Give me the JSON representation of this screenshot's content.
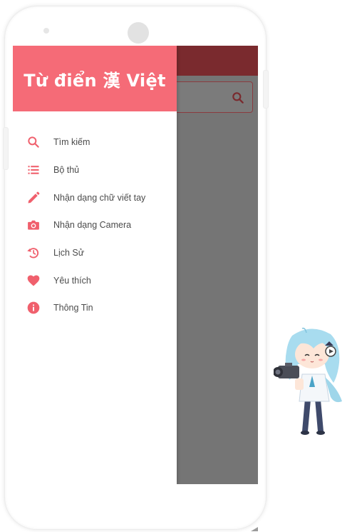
{
  "app": {
    "title": "Từ điển 漢 Việt"
  },
  "colors": {
    "accent": "#f56b77",
    "app_bar": "#7a2a2e",
    "scrim": "#757575",
    "icon": "#f0606d"
  },
  "menu": {
    "items": [
      {
        "label": "Tìm kiếm",
        "icon": "search-icon"
      },
      {
        "label": "Bộ thủ",
        "icon": "list-icon"
      },
      {
        "label": "Nhận dạng chữ viết tay",
        "icon": "pencil-icon"
      },
      {
        "label": "Nhận dạng Camera",
        "icon": "camera-icon"
      },
      {
        "label": "Lịch Sử",
        "icon": "history-icon"
      },
      {
        "label": "Yêu thích",
        "icon": "heart-icon"
      },
      {
        "label": "Thông Tin",
        "icon": "info-icon"
      }
    ]
  }
}
